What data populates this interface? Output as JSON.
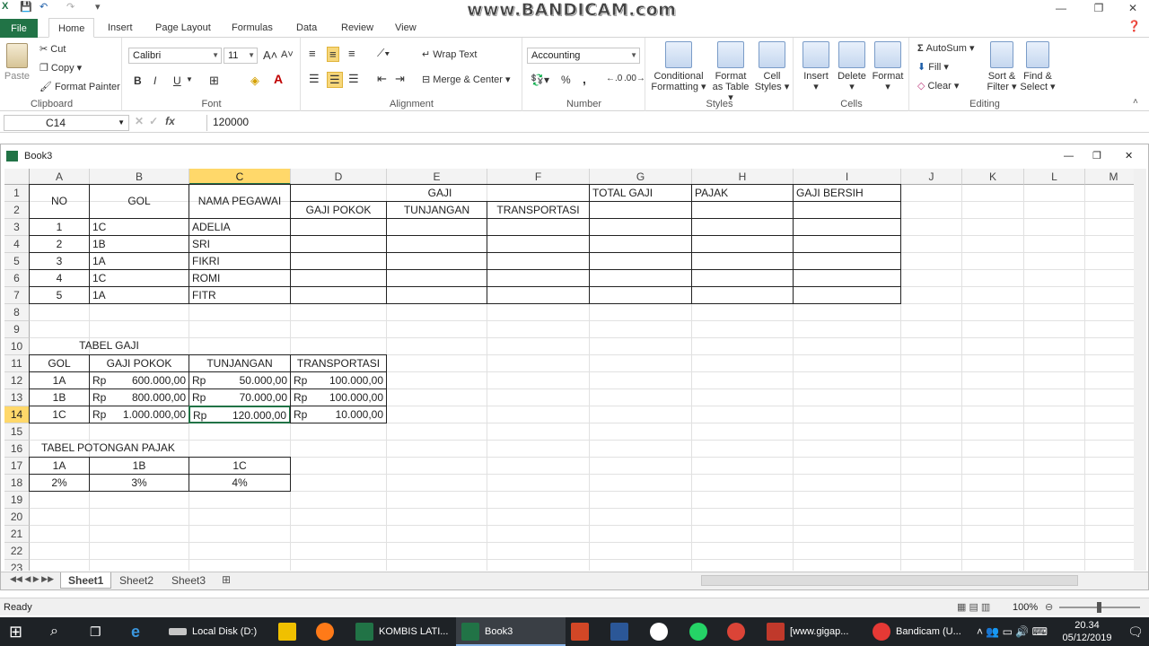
{
  "app": {
    "watermark": "www.BANDICAM.com"
  },
  "tabs": [
    "File",
    "Home",
    "Insert",
    "Page Layout",
    "Formulas",
    "Data",
    "Review",
    "View"
  ],
  "ribbon": {
    "clipboard": {
      "label": "Clipboard",
      "paste": "Paste",
      "cut": "Cut",
      "copy": "Copy",
      "format_painter": "Format Painter"
    },
    "font": {
      "label": "Font",
      "name": "Calibri",
      "size": "11",
      "bold": "B",
      "italic": "I",
      "underline": "U"
    },
    "alignment": {
      "label": "Alignment",
      "wrap": "Wrap Text",
      "merge": "Merge & Center"
    },
    "number": {
      "label": "Number",
      "format": "Accounting",
      "percent": "%",
      "comma": ","
    },
    "styles": {
      "label": "Styles",
      "conditional": "Conditional",
      "conditional2": "Formatting",
      "format_table": "Format",
      "format_table2": "as Table",
      "cell_styles": "Cell",
      "cell_styles2": "Styles"
    },
    "cells": {
      "label": "Cells",
      "insert": "Insert",
      "delete": "Delete",
      "format": "Format"
    },
    "editing": {
      "label": "Editing",
      "autosum": "AutoSum",
      "fill": "Fill",
      "clear": "Clear",
      "sort": "Sort &",
      "sort2": "Filter",
      "find": "Find &",
      "find2": "Select"
    }
  },
  "formula_bar": {
    "name_box": "C14",
    "fx": "fx",
    "value": "120000"
  },
  "workbook": {
    "title": "Book3"
  },
  "columns": [
    "A",
    "B",
    "C",
    "D",
    "E",
    "F",
    "G",
    "H",
    "I",
    "J",
    "K",
    "L",
    "M"
  ],
  "rows": [
    "1",
    "2",
    "3",
    "4",
    "5",
    "6",
    "7",
    "8",
    "9",
    "10",
    "11",
    "12",
    "13",
    "14",
    "15",
    "16",
    "17",
    "18",
    "19",
    "20",
    "21",
    "22",
    "23"
  ],
  "main_table": {
    "headers": {
      "no": "NO",
      "gol": "GOL",
      "nama": "NAMA PEGAWAI",
      "gaji": "GAJI",
      "gaji_pokok": "GAJI POKOK",
      "tunjangan": "TUNJANGAN",
      "transportasi": "TRANSPORTASI",
      "total": "TOTAL GAJI",
      "pajak": "PAJAK",
      "bersih": "GAJI BERSIH"
    },
    "rows": [
      {
        "no": "1",
        "gol": "1C",
        "nama": "ADELIA"
      },
      {
        "no": "2",
        "gol": "1B",
        "nama": "SRI"
      },
      {
        "no": "3",
        "gol": "1A",
        "nama": "FIKRI"
      },
      {
        "no": "4",
        "gol": "1C",
        "nama": "ROMI"
      },
      {
        "no": "5",
        "gol": "1A",
        "nama": "FITR"
      }
    ]
  },
  "gaji_table": {
    "title": "TABEL GAJI",
    "headers": {
      "gol": "GOL",
      "gaji_pokok": "GAJI POKOK",
      "tunjangan": "TUNJANGAN",
      "transportasi": "TRANSPORTASI"
    },
    "currency": "Rp",
    "rows": [
      {
        "gol": "1A",
        "gaji_pokok": "600.000,00",
        "tunjangan": "50.000,00",
        "transportasi": "100.000,00"
      },
      {
        "gol": "1B",
        "gaji_pokok": "800.000,00",
        "tunjangan": "70.000,00",
        "transportasi": "100.000,00"
      },
      {
        "gol": "1C",
        "gaji_pokok": "1.000.000,00",
        "tunjangan": "120.000,00",
        "transportasi": "10.000,00"
      }
    ]
  },
  "pajak_table": {
    "title": "TABEL POTONGAN PAJAK",
    "gols": [
      "1A",
      "1B",
      "1C"
    ],
    "rates": [
      "2%",
      "3%",
      "4%"
    ]
  },
  "sheets": [
    "Sheet1",
    "Sheet2",
    "Sheet3"
  ],
  "status": {
    "ready": "Ready",
    "zoom": "100%"
  },
  "taskbar": {
    "localdisk": "Local Disk (D:)",
    "kombis": "KOMBIS LATI...",
    "book3": "Book3",
    "gigap": "[www.gigap...",
    "bandicam": "Bandicam (U...",
    "time": "20.34",
    "date": "05/12/2019"
  }
}
